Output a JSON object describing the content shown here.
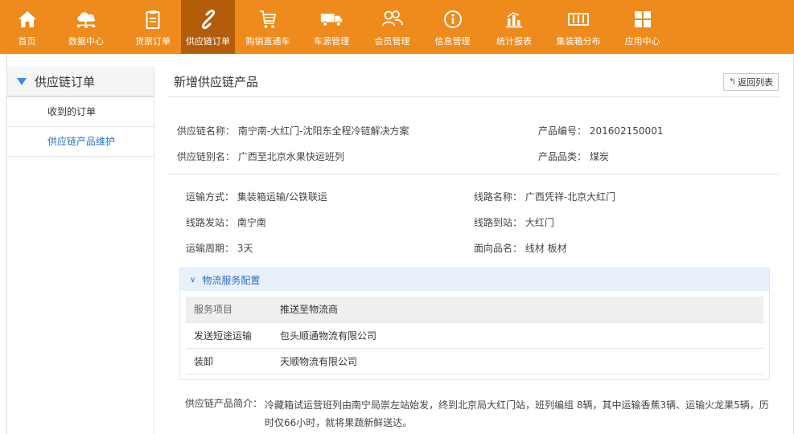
{
  "nav": {
    "items": [
      {
        "label": "首页",
        "icon": "home-icon"
      },
      {
        "label": "数据中心",
        "icon": "cloud-data-icon"
      },
      {
        "label": "货票订单",
        "icon": "clipboard-icon"
      },
      {
        "label": "供应链订单",
        "icon": "link-icon"
      },
      {
        "label": "购销直通车",
        "icon": "cart-icon"
      },
      {
        "label": "车源管理",
        "icon": "truck-icon"
      },
      {
        "label": "会员管理",
        "icon": "members-icon"
      },
      {
        "label": "信息管理",
        "icon": "info-icon"
      },
      {
        "label": "统计报表",
        "icon": "bar-chart-icon"
      },
      {
        "label": "集装箱分布",
        "icon": "container-icon"
      },
      {
        "label": "应用中心",
        "icon": "grid-icon"
      }
    ],
    "active_index": 3,
    "bg_color": "#ee8b1c",
    "active_color": "#b35c09"
  },
  "sidebar": {
    "title": "供应链订单",
    "items": [
      {
        "label": "收到的订单"
      },
      {
        "label": "供应链产品维护"
      }
    ]
  },
  "main": {
    "title": "新增供应链产品",
    "back_label": "返回列表",
    "info": {
      "chain_name_label": "供应链名称：",
      "chain_name": "南宁南-大红门-沈阳东全程冷链解决方案",
      "product_code_label": "产品编号：",
      "product_code": "201602150001",
      "chain_alias_label": "供应链别名：",
      "chain_alias": "广西至北京水果快运班列",
      "product_category_label": "产品品类：",
      "product_category": "煤炭"
    },
    "route": {
      "transport_mode_label": "运输方式：",
      "transport_mode": "集装箱运输/公铁联运",
      "route_name_label": "线路名称：",
      "route_name": "广西凭祥-北京大红门",
      "origin_label": "线路发站：",
      "origin": "南宁南",
      "destination_label": "线路到站：",
      "destination": "大红门",
      "cycle_label": "运输周期：",
      "cycle": "3天",
      "products_label": "面向品名：",
      "products": "线材 板材"
    },
    "logistics": {
      "title": "物流服务配置",
      "headers": [
        "服务项目",
        "推送至物流商"
      ],
      "rows": [
        [
          "发送短途运输",
          "包头顺通物流有限公司"
        ],
        [
          "装卸",
          "天顺物流有限公司"
        ]
      ]
    },
    "intro_label": "供应链产品简介：",
    "intro_text": "冷藏箱试运营班列由南宁局崇左站始发，终到北京局大红门站，班列编组 8辆，其中运输香蕉3辆、运输火龙果5辆，历时仅66小时，就将果蔬新鲜送达。"
  },
  "colors": {
    "link_blue": "#2a6fc7",
    "panel_blue": "#e8f1fb"
  }
}
